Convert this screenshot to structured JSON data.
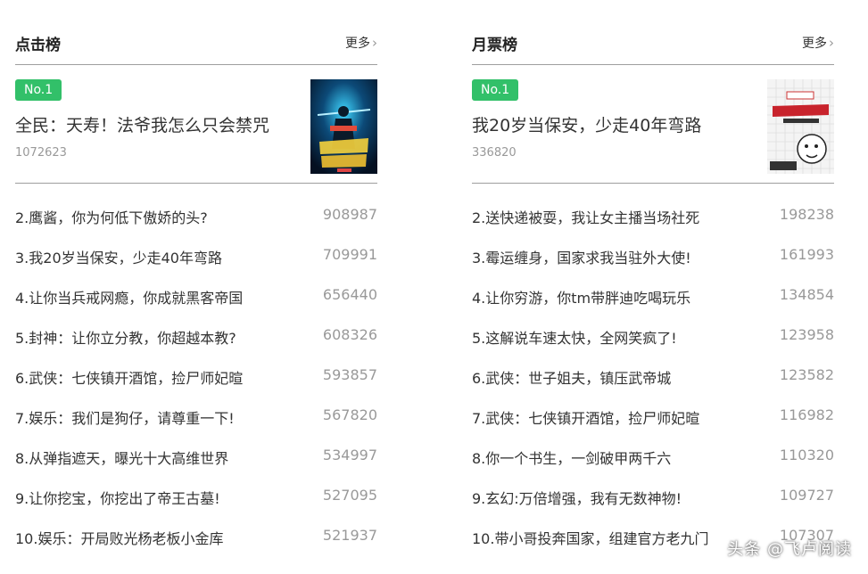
{
  "click_rank": {
    "title": "点击榜",
    "more_label": "更多",
    "top": {
      "badge": "No.1",
      "title": "全民：天寿！法爷我怎么只会禁咒",
      "count": "1072623"
    },
    "items": [
      {
        "title": "2.鹰酱，你为何低下傲娇的头?",
        "count": "908987"
      },
      {
        "title": "3.我20岁当保安，少走40年弯路",
        "count": "709991"
      },
      {
        "title": "4.让你当兵戒网瘾，你成就黑客帝国",
        "count": "656440"
      },
      {
        "title": "5.封神：让你立分教，你超越本教?",
        "count": "608326"
      },
      {
        "title": "6.武侠：七侠镇开酒馆，捡尸师妃暄",
        "count": "593857"
      },
      {
        "title": "7.娱乐：我们是狗仔，请尊重一下!",
        "count": "567820"
      },
      {
        "title": "8.从弹指遮天，曝光十大高维世界",
        "count": "534997"
      },
      {
        "title": "9.让你挖宝，你挖出了帝王古墓!",
        "count": "527095"
      },
      {
        "title": "10.娱乐：开局败光杨老板小金库",
        "count": "521937"
      }
    ]
  },
  "monthly_rank": {
    "title": "月票榜",
    "more_label": "更多",
    "top": {
      "badge": "No.1",
      "title": "我20岁当保安，少走40年弯路",
      "count": "336820"
    },
    "items": [
      {
        "title": "2.送快递被耍，我让女主播当场社死",
        "count": "198238"
      },
      {
        "title": "3.霉运缠身，国家求我当驻外大使!",
        "count": "161993"
      },
      {
        "title": "4.让你穷游，你tm带胖迪吃喝玩乐",
        "count": "134854"
      },
      {
        "title": "5.这解说车速太快，全网笑疯了!",
        "count": "123958"
      },
      {
        "title": "6.武侠：世子姐夫，镇压武帝城",
        "count": "123582"
      },
      {
        "title": "7.武侠：七侠镇开酒馆，捡尸师妃暄",
        "count": "116982"
      },
      {
        "title": "8.你一个书生，一剑破甲两千六",
        "count": "110320"
      },
      {
        "title": "9.玄幻:万倍增强，我有无数神物!",
        "count": "109727"
      },
      {
        "title": "10.带小哥投奔国家，组建官方老九门",
        "count": "107307"
      }
    ]
  },
  "watermark": "头条 @飞卢阅读",
  "colors": {
    "accent": "#32c069",
    "divider": "#9e9e9e",
    "muted": "#999999"
  }
}
